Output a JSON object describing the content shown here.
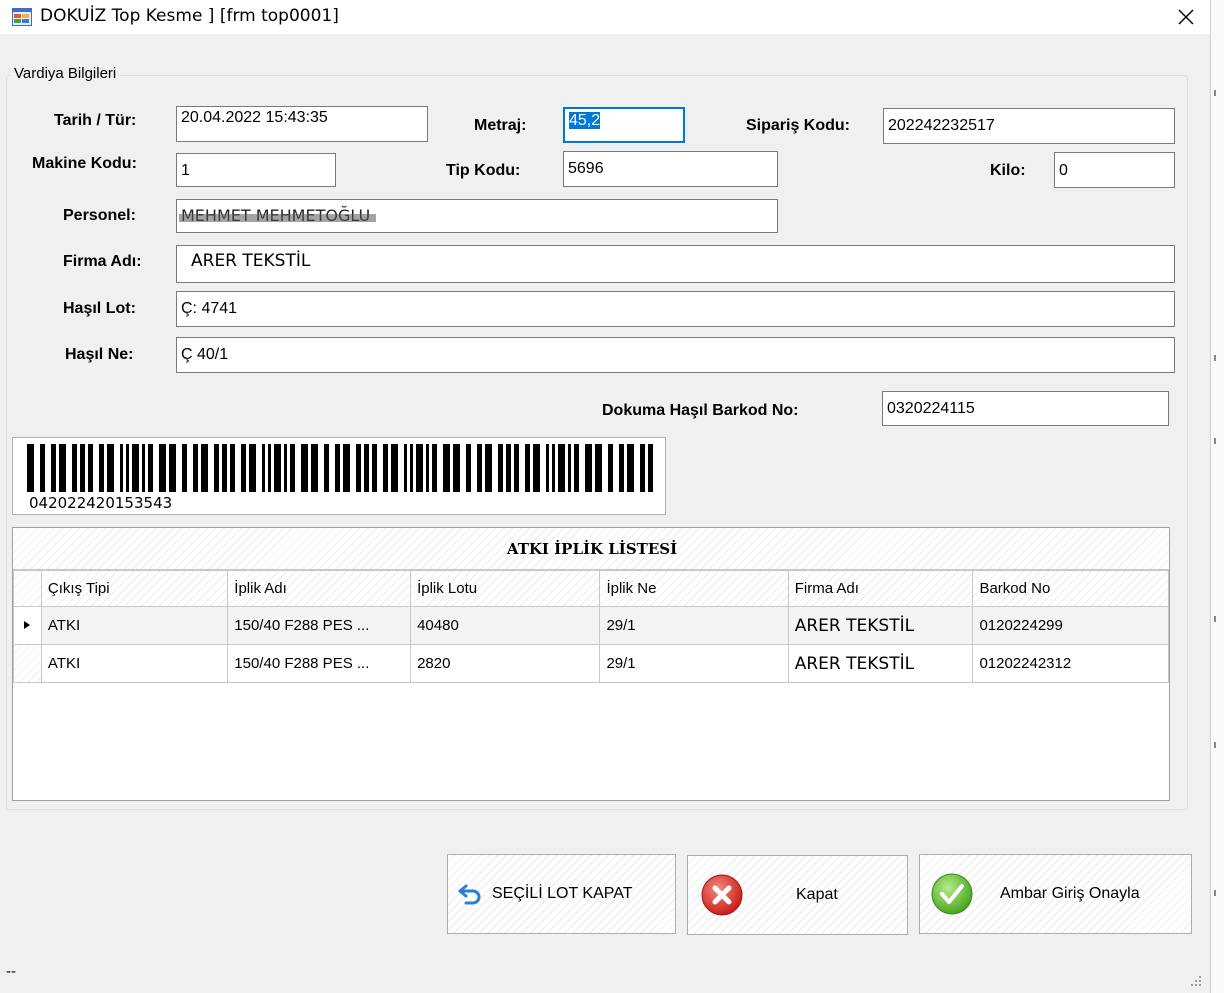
{
  "window": {
    "title": "DOKUİZ Top Kesme ] [frm top0001]"
  },
  "group": {
    "legend": "Vardiya Bilgileri"
  },
  "form": {
    "tarih_label": "Tarih / Tür:",
    "tarih_value": "20.04.2022 15:43:35",
    "metraj_label": "Metraj:",
    "metraj_value": "45,2",
    "siparis_label": "Sipariş Kodu:",
    "siparis_value": "202242232517",
    "makine_label": "Makine Kodu:",
    "makine_value": "1",
    "tip_label": "Tip Kodu:",
    "tip_value": "5696",
    "kilo_label": "Kilo:",
    "kilo_value": "0",
    "personel_label": "Personel:",
    "personel_value": "MEHMET MEHMETOĞLU",
    "firma_label": "Firma Adı:",
    "firma_value": "ARER TEKSTİL",
    "hasil_lot_label": "Haşıl Lot:",
    "hasil_lot_value": "Ç: 4741",
    "hasil_ne_label": "Haşıl Ne:",
    "hasil_ne_value": "Ç 40/1",
    "barkod_label": "Dokuma Haşıl Barkod No:",
    "barkod_value": "0320224115"
  },
  "barcode": {
    "text": "042022420153543"
  },
  "grid": {
    "title": "ATKI İPLİK LİSTESİ",
    "columns": [
      "Çıkış Tipi",
      "İplik Adı",
      "İplik Lotu",
      "İplik Ne",
      "Firma Adı",
      "Barkod No"
    ],
    "rows": [
      [
        "ATKI",
        "150/40 F288 PES ...",
        "40480",
        "29/1",
        "ARER TEKSTİL",
        "0120224299"
      ],
      [
        "ATKI",
        "150/40 F288 PES ...",
        "2820",
        "29/1",
        "ARER TEKSTİL",
        "01202242312"
      ]
    ],
    "selected_row": 0
  },
  "buttons": {
    "secili_lot_kapat": "SEÇİLİ LOT KAPAT",
    "kapat": "Kapat",
    "ambar_giris": "Ambar Giriş Onayla"
  },
  "status": {
    "text": "--"
  },
  "colors": {
    "selection": "#0078d7",
    "close_red": "#d9342b",
    "confirm_green": "#5cb82e",
    "undo_blue": "#2a7fd4"
  },
  "icons": [
    "app-icon",
    "close-icon",
    "undo-arrow-icon",
    "red-x-icon",
    "green-check-icon",
    "size-grip-icon",
    "row-pointer-icon"
  ]
}
